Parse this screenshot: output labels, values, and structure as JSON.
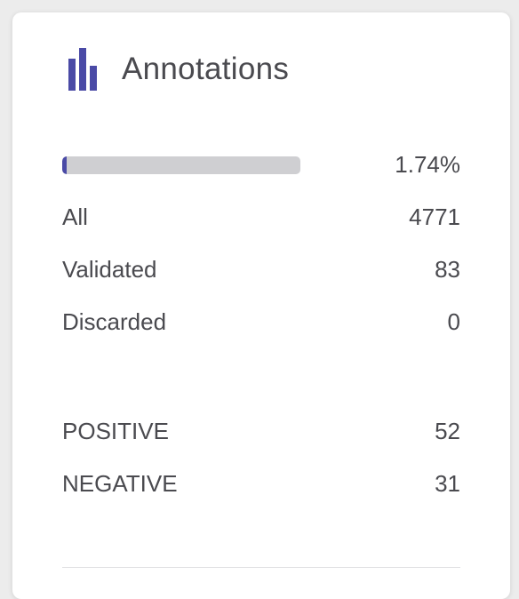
{
  "card": {
    "title": "Annotations",
    "icon": "bar-chart-icon",
    "accent_color": "#4a4aa6"
  },
  "progress": {
    "percent": 1.74,
    "label": "1.74%"
  },
  "stats": [
    {
      "label": "All",
      "value": "4771"
    },
    {
      "label": "Validated",
      "value": "83"
    },
    {
      "label": "Discarded",
      "value": "0"
    }
  ],
  "classes": [
    {
      "label": "POSITIVE",
      "value": "52"
    },
    {
      "label": "NEGATIVE",
      "value": "31"
    }
  ]
}
